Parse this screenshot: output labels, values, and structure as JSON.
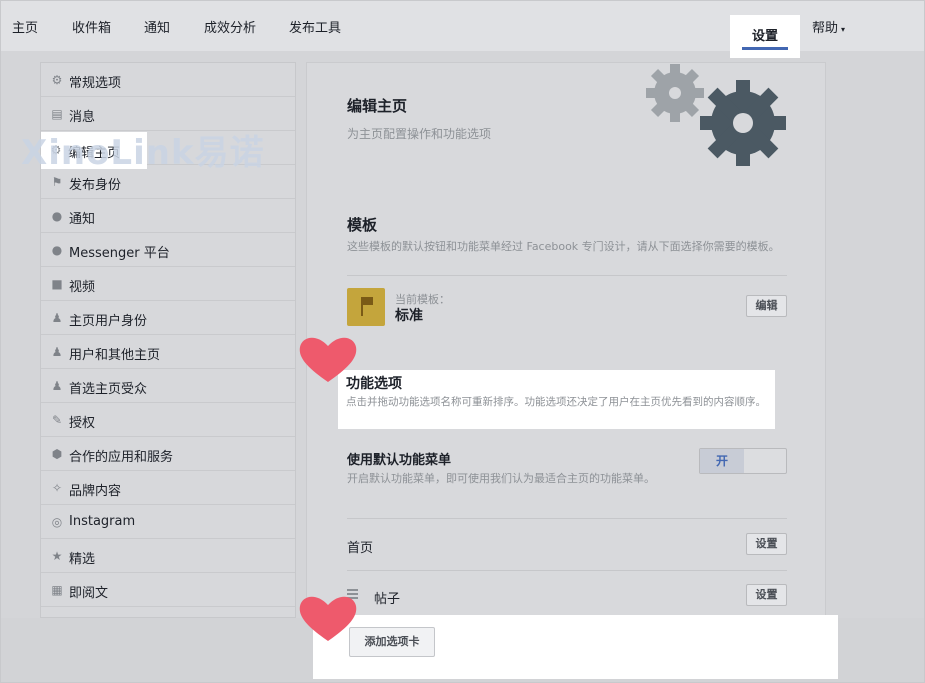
{
  "topnav": {
    "items": [
      "主页",
      "收件箱",
      "通知",
      "成效分析",
      "发布工具"
    ],
    "settings": "设置",
    "help": "帮助",
    "help_caret": "▾"
  },
  "watermark": "XinoLink易诺",
  "sidebar": {
    "items": [
      {
        "label": "常规选项",
        "icon": "gear-icon",
        "glyph": "⚙"
      },
      {
        "label": "消息",
        "icon": "message-icon",
        "glyph": "▤"
      },
      {
        "label": "编辑主页",
        "icon": "gear-icon",
        "glyph": "⚙"
      },
      {
        "label": "发布身份",
        "icon": "flag-icon",
        "glyph": "⚑"
      },
      {
        "label": "通知",
        "icon": "globe-icon",
        "glyph": "●"
      },
      {
        "label": "Messenger 平台",
        "icon": "messenger-icon",
        "glyph": "●"
      },
      {
        "label": "视频",
        "icon": "video-icon",
        "glyph": "■"
      },
      {
        "label": "主页用户身份",
        "icon": "user-icon",
        "glyph": "♟"
      },
      {
        "label": "用户和其他主页",
        "icon": "users-icon",
        "glyph": "♟"
      },
      {
        "label": "首选主页受众",
        "icon": "audience-icon",
        "glyph": "♟"
      },
      {
        "label": "授权",
        "icon": "wrench-icon",
        "glyph": "✎"
      },
      {
        "label": "合作的应用和服务",
        "icon": "cube-icon",
        "glyph": "⬢"
      },
      {
        "label": "品牌内容",
        "icon": "handshake-icon",
        "glyph": "✧"
      },
      {
        "label": "Instagram",
        "icon": "instagram-icon",
        "glyph": "◎"
      },
      {
        "label": "精选",
        "icon": "star-icon",
        "glyph": "★"
      },
      {
        "label": "即阅文",
        "icon": "article-icon",
        "glyph": "▦"
      }
    ]
  },
  "main": {
    "title": "编辑主页",
    "subtitle": "为主页配置操作和功能选项",
    "templates_title": "模板",
    "templates_desc": "这些模板的默认按钮和功能菜单经过 Facebook 专门设计，请从下面选择你需要的模板。",
    "current_template_label": "当前模板：",
    "current_template_value": "标准",
    "edit_button": "编辑",
    "features_title": "功能选项",
    "features_desc": "点击并拖动功能选项名称可重新排序。功能选项还决定了用户在主页优先看到的内容顺序。",
    "default_menu_title": "使用默认功能菜单",
    "default_menu_desc": "开启默认功能菜单，即可使用我们认为最适合主页的功能菜单。",
    "toggle_on": "开",
    "tabs": [
      {
        "label": "首页",
        "button": "设置"
      },
      {
        "label": "帖子",
        "button": "设置"
      }
    ],
    "add_tab_button": "添加选项卡"
  },
  "colors": {
    "accent": "#4267b2",
    "heart": "#ee5a6c",
    "gear_dark": "#4b5963",
    "gear_light": "#9ea3a8"
  }
}
